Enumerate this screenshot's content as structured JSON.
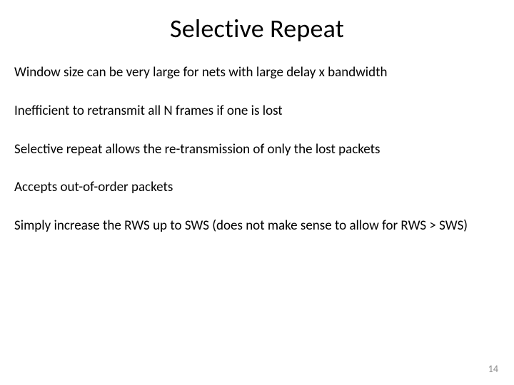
{
  "title": "Selective Repeat",
  "paragraphs": [
    "Window size can be very large for nets with large delay x bandwidth",
    "Inefficient to retransmit all N frames if one is lost",
    "Selective repeat allows the  re-transmission of only the lost packets",
    "Accepts out-of-order packets",
    "Simply increase the RWS up to SWS (does not make sense to allow for RWS > SWS)"
  ],
  "page_number": "14"
}
